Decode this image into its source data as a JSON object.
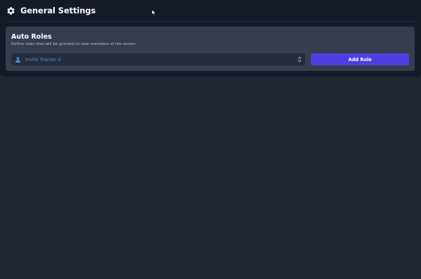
{
  "header": {
    "title": "General Settings",
    "icon": "gear-icon"
  },
  "auto_roles": {
    "title": "Auto Roles",
    "description": "Define roles that will be granted to new members of the server.",
    "select": {
      "value": "Invite Tracker A",
      "value_color": "#3e8ee8",
      "icon": "user-icon"
    },
    "add_button_label": "Add Role",
    "accent": "#4f3ee1"
  },
  "mouse_cursor": "arrow-cursor"
}
